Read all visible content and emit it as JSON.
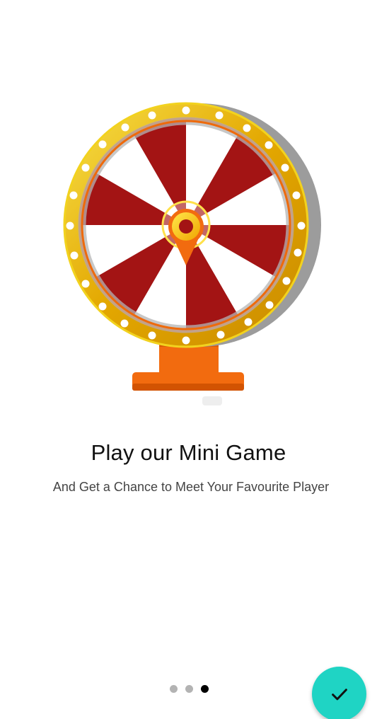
{
  "onboarding": {
    "title": "Play our Mini Game",
    "subtitle": "And Get a Chance to Meet Your Favourite Player",
    "page_count": 3,
    "current_page": 3
  },
  "illustration": {
    "icon": "prize-wheel-icon"
  },
  "fab": {
    "icon": "check-icon",
    "color": "#1fd4c4"
  },
  "colors": {
    "wheel_red": "#a31414",
    "wheel_gold": "#e8b400",
    "wheel_orange": "#f06d0a"
  }
}
